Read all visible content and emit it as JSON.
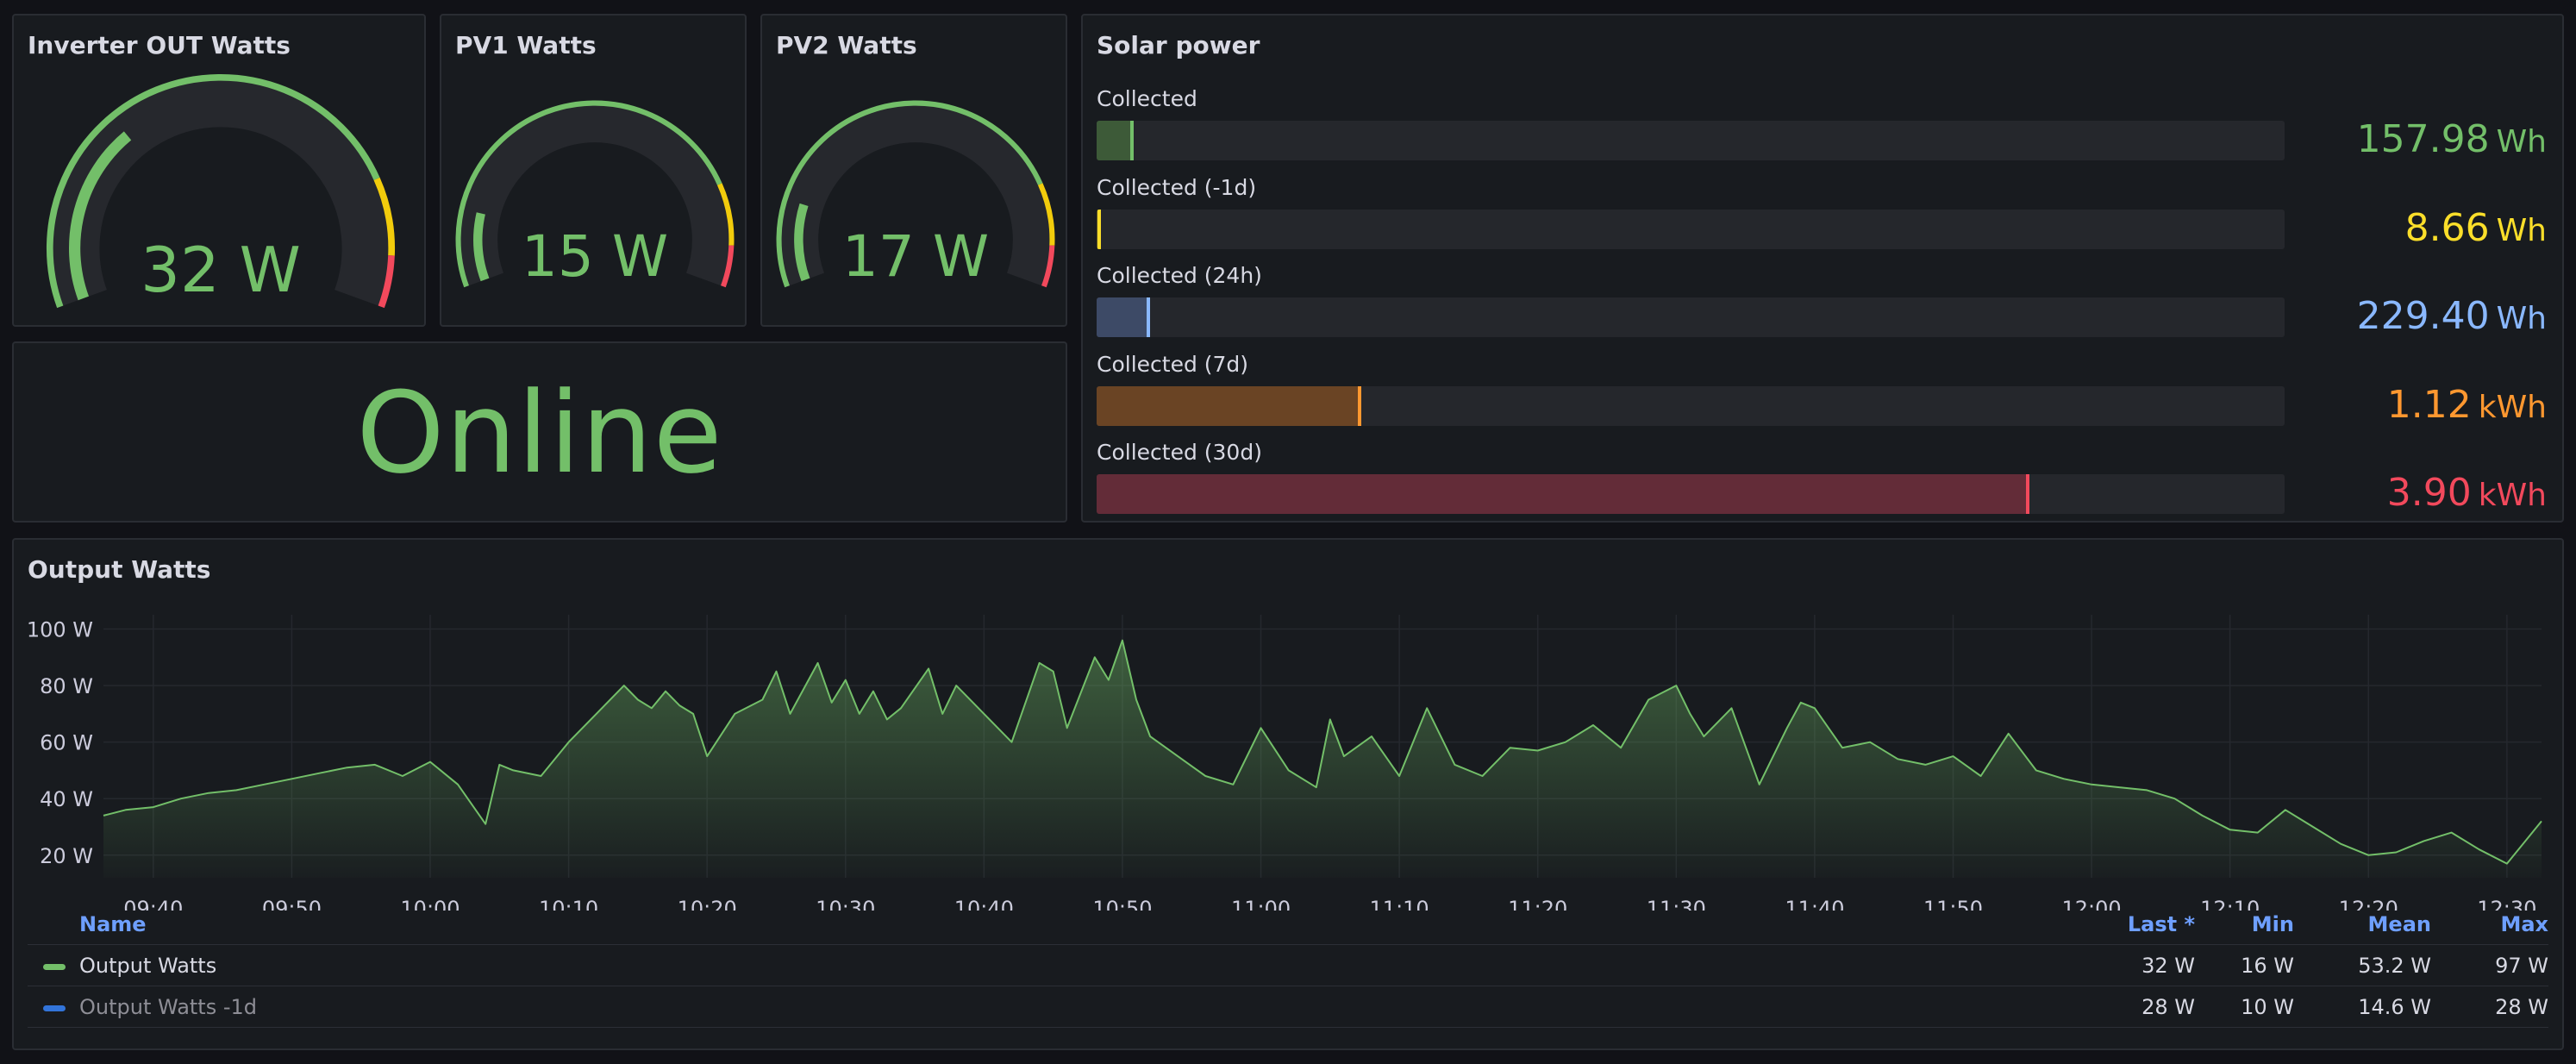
{
  "gauges": [
    {
      "title": "Inverter OUT Watts",
      "value": 32,
      "display": "32 W",
      "min": 0,
      "max": 100,
      "color": "#73bf69",
      "thresholds": [
        {
          "from": 0,
          "color": "#73bf69"
        },
        {
          "from": 80,
          "color": "#f2cc0c"
        },
        {
          "from": 92,
          "color": "#f2495c"
        }
      ]
    },
    {
      "title": "PV1 Watts",
      "value": 15,
      "display": "15 W",
      "min": 0,
      "max": 100,
      "color": "#73bf69",
      "thresholds": [
        {
          "from": 0,
          "color": "#73bf69"
        },
        {
          "from": 80,
          "color": "#f2cc0c"
        },
        {
          "from": 92,
          "color": "#f2495c"
        }
      ]
    },
    {
      "title": "PV2 Watts",
      "value": 17,
      "display": "17 W",
      "min": 0,
      "max": 100,
      "color": "#73bf69",
      "thresholds": [
        {
          "from": 0,
          "color": "#73bf69"
        },
        {
          "from": 80,
          "color": "#f2cc0c"
        },
        {
          "from": 92,
          "color": "#f2495c"
        }
      ]
    }
  ],
  "status": {
    "text": "Online",
    "color": "#73bf69"
  },
  "solar": {
    "title": "Solar power",
    "rows": [
      {
        "label": "Collected",
        "value": "157.98",
        "unit": "Wh",
        "fraction": 0.031,
        "color": "#73bf69",
        "fill": "#3d5a38"
      },
      {
        "label": "Collected (-1d)",
        "value": "8.66",
        "unit": "Wh",
        "fraction": 0.003,
        "color": "#fade2a",
        "fill": "#5c5424"
      },
      {
        "label": "Collected (24h)",
        "value": "229.40",
        "unit": "Wh",
        "fraction": 0.045,
        "color": "#8ab8ff",
        "fill": "#3d4a66"
      },
      {
        "label": "Collected (7d)",
        "value": "1.12",
        "unit": "kWh",
        "fraction": 0.223,
        "color": "#ff9830",
        "fill": "#6a4424"
      },
      {
        "label": "Collected (30d)",
        "value": "3.90",
        "unit": "kWh",
        "fraction": 0.785,
        "color": "#f2495c",
        "fill": "#632c38"
      }
    ]
  },
  "output": {
    "title": "Output Watts",
    "legend": {
      "headers": {
        "name": "Name",
        "last": "Last *",
        "min": "Min",
        "mean": "Mean",
        "max": "Max"
      },
      "rows": [
        {
          "name": "Output Watts",
          "color": "#73bf69",
          "last": "32 W",
          "min": "16 W",
          "mean": "53.2 W",
          "max": "97 W",
          "dimmed": false
        },
        {
          "name": "Output Watts -1d",
          "color": "#3274d9",
          "last": "28 W",
          "min": "10 W",
          "mean": "14.6 W",
          "max": "28 W",
          "dimmed": true
        }
      ]
    }
  },
  "chart_data": {
    "type": "area",
    "title": "Output Watts",
    "ylim": [
      12,
      102
    ],
    "y_ticks": [
      "20 W",
      "40 W",
      "60 W",
      "80 W",
      "100 W"
    ],
    "y_tick_values": [
      20,
      40,
      60,
      80,
      100
    ],
    "x_ticks": [
      "09:40",
      "09:50",
      "10:00",
      "10:10",
      "10:20",
      "10:30",
      "10:40",
      "10:50",
      "11:00",
      "11:10",
      "11:20",
      "11:30",
      "11:40",
      "11:50",
      "12:00",
      "12:10",
      "12:20",
      "12:30"
    ],
    "x_tick_minutes": [
      -20,
      -10,
      0,
      10,
      20,
      30,
      40,
      50,
      60,
      70,
      80,
      90,
      100,
      110,
      120,
      130,
      140,
      150
    ],
    "x_range_minutes": [
      -23.6,
      152.5
    ],
    "grid": true,
    "series": [
      {
        "name": "Output Watts",
        "color": "#73bf69",
        "x_minutes": [
          -23.6,
          -22,
          -20,
          -18,
          -16,
          -14,
          -12,
          -10,
          -8,
          -6,
          -4,
          -2,
          0,
          2,
          4,
          5,
          6,
          8,
          10,
          12,
          14,
          15,
          16,
          17,
          18,
          19,
          20,
          22,
          24,
          25,
          26,
          28,
          29,
          30,
          31,
          32,
          33,
          34,
          36,
          37,
          38,
          40,
          42,
          44,
          45,
          46,
          48,
          49,
          50,
          51,
          52,
          54,
          56,
          58,
          60,
          62,
          64,
          65,
          66,
          68,
          70,
          72,
          74,
          76,
          78,
          80,
          82,
          84,
          86,
          88,
          90,
          91,
          92,
          94,
          96,
          98,
          99,
          100,
          102,
          104,
          106,
          108,
          110,
          112,
          114,
          116,
          118,
          120,
          122,
          124,
          126,
          128,
          130,
          132,
          134,
          136,
          138,
          140,
          142,
          144,
          146,
          148,
          150,
          152.5
        ],
        "values": [
          34,
          36,
          37,
          40,
          42,
          43,
          45,
          47,
          49,
          51,
          52,
          48,
          53,
          45,
          31,
          52,
          50,
          48,
          60,
          70,
          80,
          75,
          72,
          78,
          73,
          70,
          55,
          70,
          75,
          85,
          70,
          88,
          74,
          82,
          70,
          78,
          68,
          72,
          86,
          70,
          80,
          70,
          60,
          88,
          85,
          65,
          90,
          82,
          96,
          75,
          62,
          55,
          48,
          45,
          65,
          50,
          44,
          68,
          55,
          62,
          48,
          72,
          52,
          48,
          58,
          57,
          60,
          66,
          58,
          75,
          80,
          70,
          62,
          72,
          45,
          65,
          74,
          72,
          58,
          60,
          54,
          52,
          55,
          48,
          63,
          50,
          47,
          45,
          44,
          43,
          40,
          34,
          29,
          28,
          36,
          30,
          24,
          20,
          21,
          25,
          28,
          22,
          17,
          32
        ]
      }
    ]
  }
}
